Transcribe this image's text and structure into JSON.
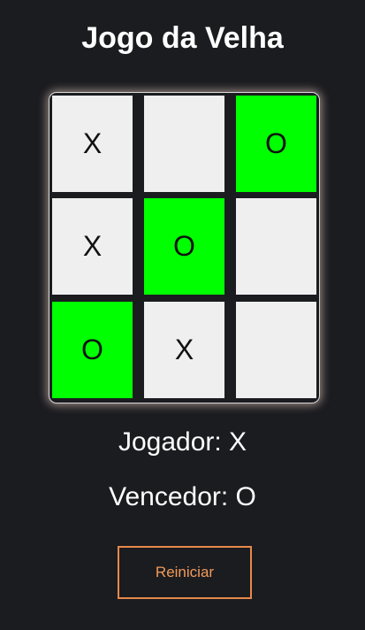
{
  "title": "Jogo da Velha",
  "board": {
    "cells": [
      {
        "value": "X",
        "winning": false
      },
      {
        "value": "",
        "winning": false
      },
      {
        "value": "O",
        "winning": true
      },
      {
        "value": "X",
        "winning": false
      },
      {
        "value": "O",
        "winning": true
      },
      {
        "value": "",
        "winning": false
      },
      {
        "value": "O",
        "winning": true
      },
      {
        "value": "X",
        "winning": false
      },
      {
        "value": "",
        "winning": false
      }
    ]
  },
  "status": {
    "player_text": "Jogador: X",
    "winner_text": "Vencedor: O"
  },
  "reset_label": "Reiniciar",
  "colors": {
    "background": "#1b1c20",
    "cell": "#efefef",
    "winning_cell": "#00ff00",
    "button_accent": "#e8894a"
  }
}
